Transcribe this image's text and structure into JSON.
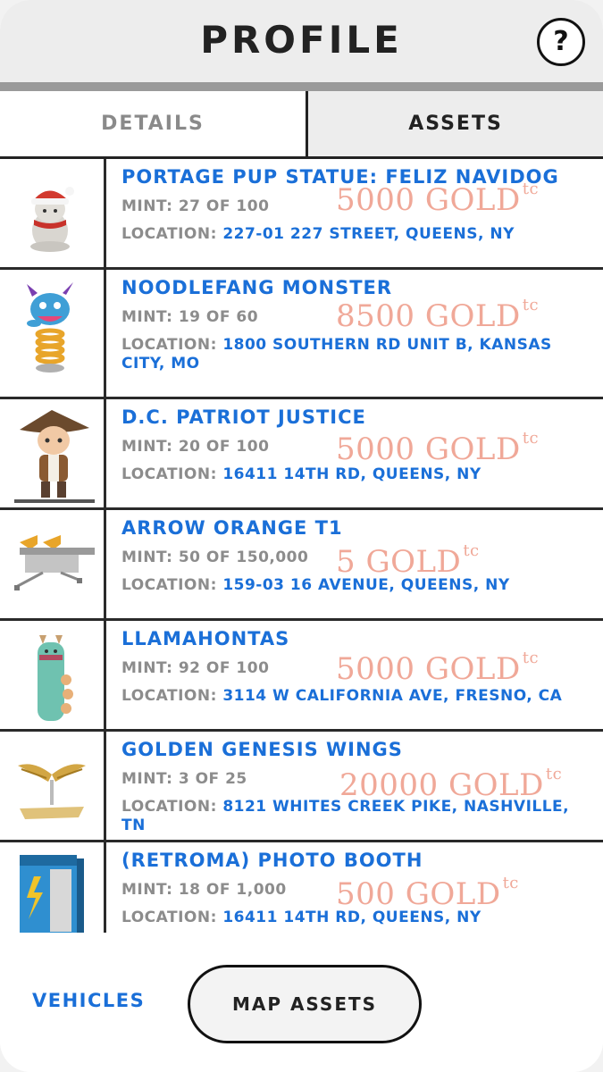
{
  "header": {
    "title": "PROFILE",
    "help_label": "?"
  },
  "tabs": [
    {
      "label": "DETAILS",
      "active": false
    },
    {
      "label": "ASSETS",
      "active": true
    }
  ],
  "location_label": "LOCATION:",
  "price_suffix": "tc",
  "assets": [
    {
      "name": "PORTAGE PUP STATUE: FELIZ NAVIDOG",
      "mint": "MINT: 27 OF 100",
      "price": "5000 GOLD",
      "location": "227-01 227 STREET, QUEENS, NY",
      "icon": "santa-dog-statue-icon"
    },
    {
      "name": "NOODLEFANG MONSTER",
      "mint": "MINT: 19 OF 60",
      "price": "8500 GOLD",
      "location": "1800 SOUTHERN RD UNIT B, KANSAS CITY, MO",
      "icon": "spring-monster-icon"
    },
    {
      "name": "D.C. PATRIOT JUSTICE",
      "mint": "MINT: 20 OF 100",
      "price": "5000 GOLD",
      "location": "16411 14TH RD, QUEENS, NY",
      "icon": "patriot-figure-icon"
    },
    {
      "name": "ARROW ORANGE T1",
      "mint": "MINT: 50 OF 150,000",
      "price": "5 GOLD",
      "location": "159-03 16 AVENUE, QUEENS, NY",
      "icon": "arrow-bench-icon"
    },
    {
      "name": "LLAMAHONTAS",
      "mint": "MINT: 92 OF 100",
      "price": "5000 GOLD",
      "location": "3114 W CALIFORNIA AVE, FRESNO, CA",
      "icon": "llama-statue-icon"
    },
    {
      "name": "GOLDEN GENESIS WINGS",
      "mint": "MINT: 3 OF 25",
      "price": "20000 GOLD",
      "location": "8121 WHITES CREEK PIKE, NASHVILLE, TN",
      "icon": "golden-wings-icon"
    },
    {
      "name": "(RETROMA) PHOTO BOOTH",
      "mint": "MINT: 18 OF 1,000",
      "price": "500 GOLD",
      "location": "16411 14TH RD, QUEENS, NY",
      "icon": "photo-booth-icon"
    }
  ],
  "footer": {
    "vehicles_label": "VEHICLES",
    "map_assets_label": "MAP ASSETS"
  },
  "colors": {
    "link_blue": "#1a6fd8",
    "price_salmon": "#f0a898",
    "muted_gray": "#8c8c8c"
  }
}
